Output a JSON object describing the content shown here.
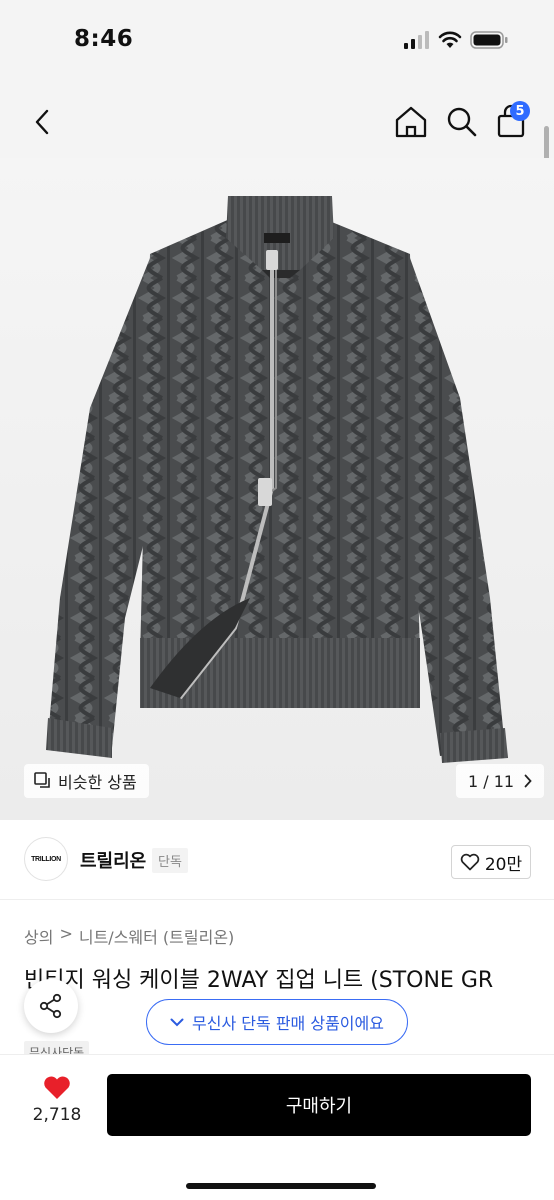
{
  "status": {
    "time": "8:46"
  },
  "header": {
    "cart_count": "5"
  },
  "gallery": {
    "similar_label": "비슷한 상품",
    "counter": "1 / 11"
  },
  "brand": {
    "logo_text": "TRILLION",
    "name": "트릴리온",
    "tag": "단독",
    "likes": "20만"
  },
  "breadcrumb": {
    "level1": "상의",
    "separator": ">",
    "level2": "니트/스웨터 (트릴리온)"
  },
  "product": {
    "title": "빈티지 워싱 케이블 2WAY 집업 니트 (STONE GR",
    "tag": "무신사단독"
  },
  "toast": {
    "text": "무신사 단독 판매 상품이에요"
  },
  "bottom": {
    "favorites": "2,718",
    "buy_label": "구매하기"
  },
  "colors": {
    "accent": "#2f6bff",
    "buy_button": "#000000",
    "heart": "#e8202a",
    "sweater": "#4a4c4e"
  }
}
